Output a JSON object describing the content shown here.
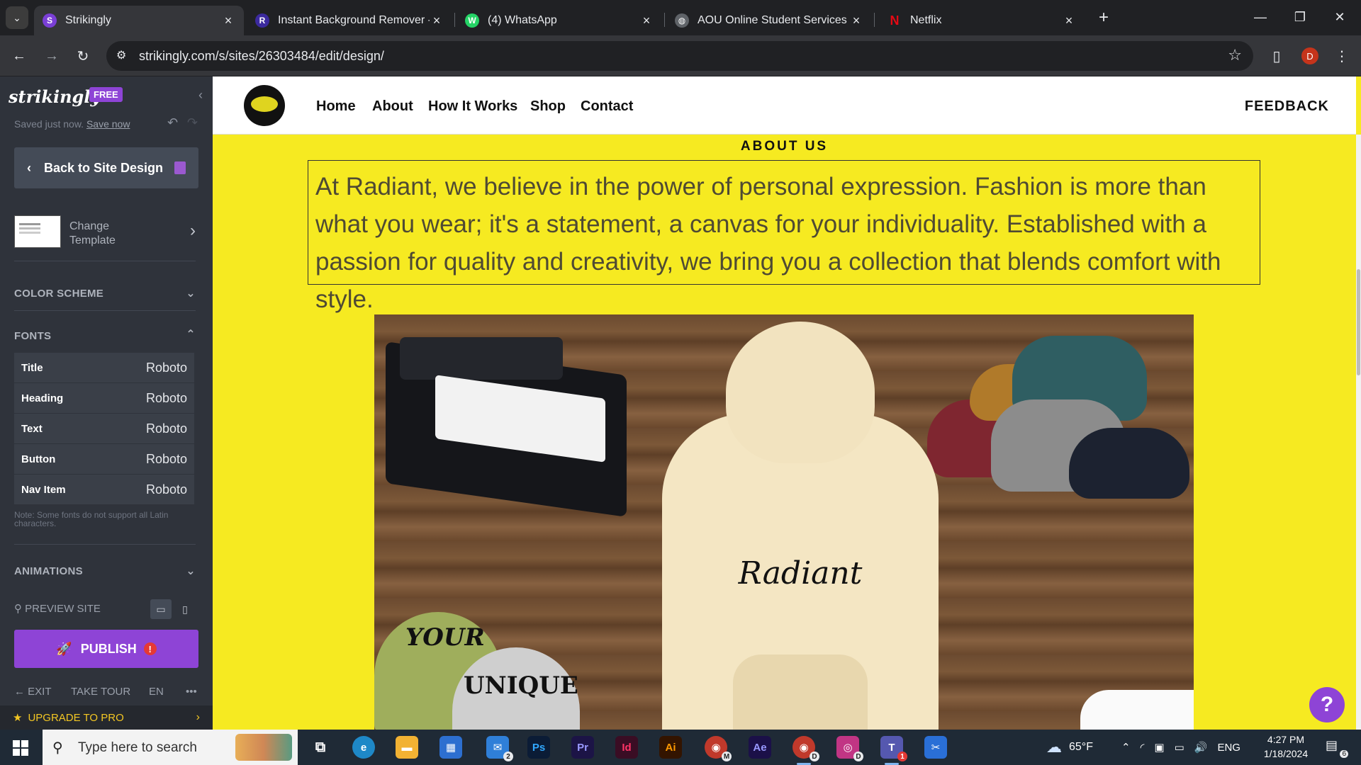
{
  "browser": {
    "tabs": [
      {
        "title": "Strikingly",
        "favicon": "S",
        "color": "#7a3fd6",
        "active": true
      },
      {
        "title": "Instant Background Remover - I",
        "favicon": "R",
        "color": "#3b2a9e",
        "active": false
      },
      {
        "title": "(4) WhatsApp",
        "favicon": "W",
        "color": "#25d366",
        "active": false
      },
      {
        "title": "AOU Online Student Services - (",
        "favicon": "◍",
        "color": "#5f6368",
        "active": false
      },
      {
        "title": "Netflix",
        "favicon": "N",
        "color": "#e50914",
        "active": false
      }
    ],
    "new_tab": "+",
    "url": "strikingly.com/s/sites/26303484/edit/design/",
    "profile_initial": "D"
  },
  "sidebar": {
    "logo": "strikingly",
    "plan_badge": "FREE",
    "saved_text": "Saved just now.",
    "save_now": "Save now",
    "back_button": "Back to Site Design",
    "change_template": "Change Template",
    "color_scheme": "COLOR SCHEME",
    "fonts_header": "FONTS",
    "fonts": [
      {
        "label": "Title",
        "value": "Roboto"
      },
      {
        "label": "Heading",
        "value": "Roboto"
      },
      {
        "label": "Text",
        "value": "Roboto"
      },
      {
        "label": "Button",
        "value": "Roboto"
      },
      {
        "label": "Nav Item",
        "value": "Roboto"
      }
    ],
    "fonts_note": "Note: Some fonts do not support all Latin characters.",
    "animations": "ANIMATIONS",
    "preview_site": "PREVIEW SITE",
    "publish": "PUBLISH",
    "publish_alert": "!",
    "exit": "EXIT",
    "take_tour": "TAKE TOUR",
    "language": "EN",
    "more": "•••",
    "upgrade": "UPGRADE TO PRO"
  },
  "site": {
    "nav": [
      "Home",
      "About",
      "How It Works",
      "Shop",
      "Contact"
    ],
    "feedback": "FEEDBACK",
    "about_title": "ABOUT US",
    "about_text": "At Radiant, we believe in the power of personal expression. Fashion is more than what you wear; it's a statement, a canvas for your individuality. Established with a passion for quality and creativity, we bring you a collection that blends comfort with style.",
    "hero_brand": "Radiant",
    "beanie_text_1": "YOUR",
    "beanie_text_2": "UNIQUE",
    "help": "?",
    "background_color": "#f6ea21",
    "accent_color": "#8e44d6"
  },
  "taskbar": {
    "search_placeholder": "Type here to search",
    "apps": [
      {
        "name": "task-view",
        "label": "⧉",
        "color": "transparent"
      },
      {
        "name": "edge",
        "label": "e",
        "color": "#1e88c7"
      },
      {
        "name": "file-explorer",
        "label": "▬",
        "color": "#f2b233"
      },
      {
        "name": "microsoft-store",
        "label": "▦",
        "color": "#2d6fd0"
      },
      {
        "name": "mail",
        "label": "✉",
        "color": "#2f7fd8",
        "badge": "2"
      },
      {
        "name": "photoshop",
        "label": "Ps",
        "color": "#0b1c36"
      },
      {
        "name": "premiere",
        "label": "Pr",
        "color": "#1c1446"
      },
      {
        "name": "indesign",
        "label": "Id",
        "color": "#3a0d24"
      },
      {
        "name": "illustrator",
        "label": "Ai",
        "color": "#331400"
      },
      {
        "name": "chrome-m",
        "label": "◉",
        "color": "#c0392b",
        "badge": "M"
      },
      {
        "name": "after-effects",
        "label": "Ae",
        "color": "#1b1048"
      },
      {
        "name": "chrome-d",
        "label": "◉",
        "color": "#c0392b",
        "badge": "D"
      },
      {
        "name": "instagram",
        "label": "◎",
        "color": "#c13584",
        "badge": "D"
      },
      {
        "name": "teams",
        "label": "T",
        "color": "#5558af",
        "badge": "1"
      },
      {
        "name": "snip",
        "label": "✂",
        "color": "#2a6fd6"
      }
    ],
    "weather": "65°F",
    "language": "ENG",
    "time": "4:27 PM",
    "date": "1/18/2024",
    "notifications": "6"
  }
}
